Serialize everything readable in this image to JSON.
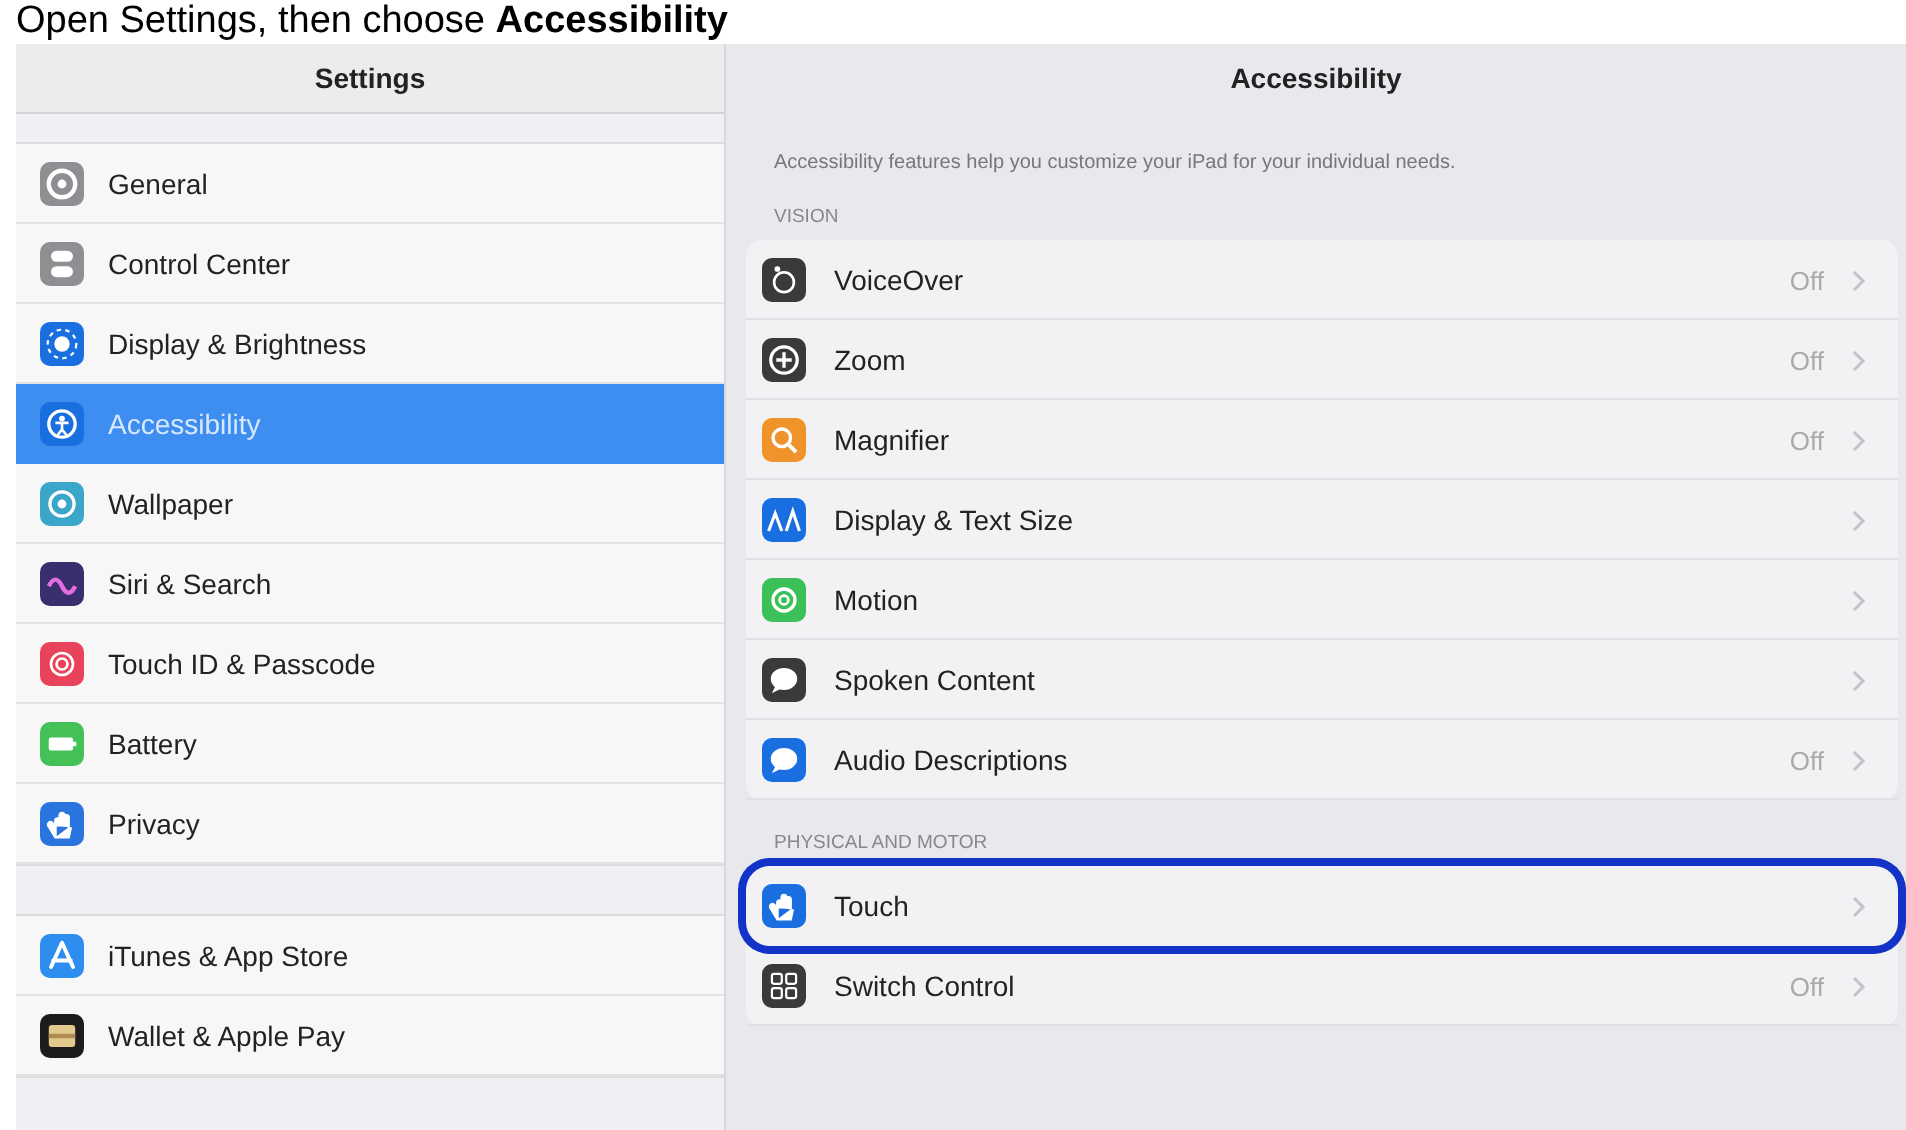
{
  "caption": "Open Settings, then choose **Accessibility**",
  "sidebar": {
    "title": "Settings",
    "groups": [
      {
        "items": [
          {
            "label": "General",
            "color": "#8e8e93",
            "selected": false
          },
          {
            "label": "Control Center",
            "color": "#8e8e93",
            "selected": false
          },
          {
            "label": "Display & Brightness",
            "color": "#1a6fe0",
            "selected": false
          },
          {
            "label": "Accessibility",
            "color": "#1a6fe0",
            "selected": true
          },
          {
            "label": "Wallpaper",
            "color": "#3aa6c9",
            "selected": false
          },
          {
            "label": "Siri & Search",
            "color": "#3a2f6e",
            "selected": false
          },
          {
            "label": "Touch ID & Passcode",
            "color": "#e8435a",
            "selected": false
          },
          {
            "label": "Battery",
            "color": "#43c157",
            "selected": false
          },
          {
            "label": "Privacy",
            "color": "#2a74e0",
            "selected": false
          }
        ]
      },
      {
        "items": [
          {
            "label": "iTunes & App Store",
            "color": "#2e8ef0",
            "selected": false
          },
          {
            "label": "Wallet & Apple Pay",
            "color": "#1c1c1e",
            "selected": false
          }
        ]
      }
    ]
  },
  "detail": {
    "title": "Accessibility",
    "description": "Accessibility features help you customize your iPad for your individual needs.",
    "sections": [
      {
        "header": "VISION",
        "rows": [
          {
            "label": "VoiceOver",
            "value": "Off",
            "color": "#3a3a3c",
            "highlighted": false
          },
          {
            "label": "Zoom",
            "value": "Off",
            "color": "#3a3a3c",
            "highlighted": false
          },
          {
            "label": "Magnifier",
            "value": "Off",
            "color": "#f0932b",
            "highlighted": false
          },
          {
            "label": "Display & Text Size",
            "color": "#1a6fe0",
            "highlighted": false
          },
          {
            "label": "Motion",
            "color": "#3cc05a",
            "highlighted": false
          },
          {
            "label": "Spoken Content",
            "color": "#3a3a3c",
            "highlighted": false
          },
          {
            "label": "Audio Descriptions",
            "value": "Off",
            "color": "#1a6fe0",
            "highlighted": false
          }
        ]
      },
      {
        "header": "PHYSICAL AND MOTOR",
        "rows": [
          {
            "label": "Touch",
            "color": "#1a6fe0",
            "highlighted": true
          },
          {
            "label": "Switch Control",
            "value": "Off",
            "color": "#3a3a3c",
            "highlighted": false
          }
        ]
      }
    ]
  }
}
